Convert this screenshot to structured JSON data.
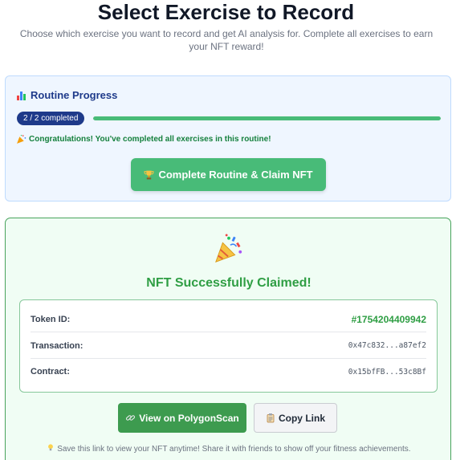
{
  "header": {
    "title": "Select Exercise to Record",
    "subtitle": "Choose which exercise you want to record and get AI analysis for. Complete all exercises to earn your NFT reward!"
  },
  "routine_progress": {
    "title": "Routine Progress",
    "title_icon": "bar-chart-icon",
    "badge": "2 / 2 completed",
    "progress": 1.0,
    "congrats_icon": "party-popper-icon",
    "congrats_text": "Congratulations! You've completed all exercises in this routine!",
    "claim_icon": "trophy-icon",
    "claim_button_label": "Complete Routine & Claim NFT"
  },
  "nft_claim": {
    "icon": "party-popper-icon",
    "heading": "NFT Successfully Claimed!",
    "details": [
      {
        "label": "Token ID:",
        "value": "#1754204409942"
      },
      {
        "label": "Transaction:",
        "value": "0x47c832...a87ef2"
      },
      {
        "label": "Contract:",
        "value": "0x15bfFB...53c8Bf"
      }
    ],
    "view_icon": "link-icon",
    "view_button_label": "View on PolygonScan",
    "copy_icon": "clipboard-icon",
    "copy_button_label": "Copy Link",
    "note_icon": "lightbulb-icon",
    "save_note": "Save this link to view your NFT anytime! Share it with friends to show off your fitness achievements."
  },
  "colors": {
    "accent_green": "#48bb78",
    "dark_green": "#2f9e44",
    "navy": "#1e3a8a",
    "progress_bg": "#eff6ff",
    "nft_bg": "#f0fdf4"
  }
}
